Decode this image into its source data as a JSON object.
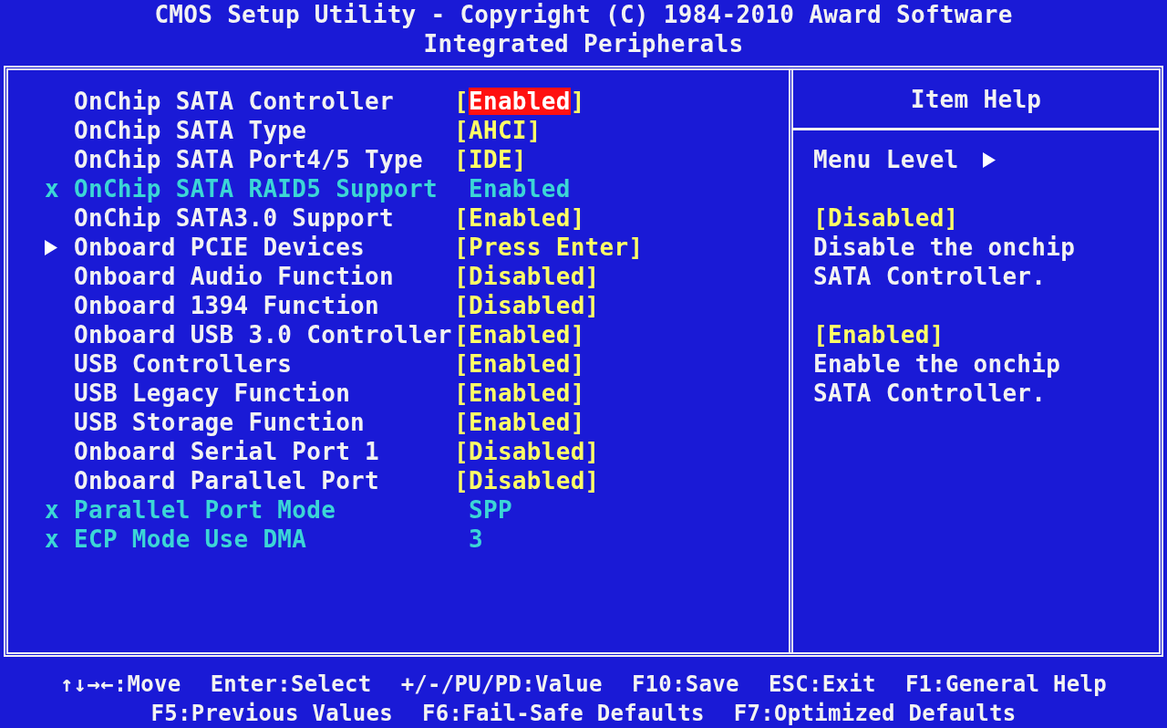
{
  "header": {
    "title": "CMOS Setup Utility - Copyright (C) 1984-2010 Award Software",
    "subtitle": "Integrated Peripherals"
  },
  "settings": [
    {
      "kind": "option",
      "label": "OnChip SATA Controller",
      "open": "[",
      "value": "Enabled",
      "close": "]",
      "selected": true
    },
    {
      "kind": "option",
      "label": "OnChip SATA Type",
      "open": "[",
      "value": "AHCI",
      "close": "]",
      "selected": false
    },
    {
      "kind": "option",
      "label": "OnChip SATA Port4/5 Type",
      "open": "[",
      "value": "IDE",
      "close": "]",
      "selected": false
    },
    {
      "kind": "locked",
      "marker": "x",
      "label": "OnChip SATA RAID5 Support",
      "value": "Enabled",
      "selected": false
    },
    {
      "kind": "option",
      "label": "OnChip SATA3.0 Support",
      "open": "[",
      "value": "Enabled",
      "close": "]",
      "selected": false
    },
    {
      "kind": "submenu",
      "label": "Onboard PCIE Devices",
      "open": "[",
      "value": "Press Enter",
      "close": "]",
      "selected": false
    },
    {
      "kind": "option",
      "label": "Onboard Audio Function",
      "open": "[",
      "value": "Disabled",
      "close": "]",
      "selected": false
    },
    {
      "kind": "option",
      "label": "Onboard 1394 Function",
      "open": "[",
      "value": "Disabled",
      "close": "]",
      "selected": false
    },
    {
      "kind": "option",
      "label": "Onboard USB 3.0 Controller",
      "open": "[",
      "value": "Enabled",
      "close": "]",
      "selected": false
    },
    {
      "kind": "option",
      "label": "USB Controllers",
      "open": "[",
      "value": "Enabled",
      "close": "]",
      "selected": false
    },
    {
      "kind": "option",
      "label": "USB Legacy Function",
      "open": "[",
      "value": "Enabled",
      "close": "]",
      "selected": false
    },
    {
      "kind": "option",
      "label": "USB Storage Function",
      "open": "[",
      "value": "Enabled",
      "close": "]",
      "selected": false
    },
    {
      "kind": "option",
      "label": "Onboard Serial Port 1",
      "open": "[",
      "value": "Disabled",
      "close": "]",
      "selected": false
    },
    {
      "kind": "option",
      "label": "Onboard Parallel Port",
      "open": "[",
      "value": "Disabled",
      "close": "]",
      "selected": false
    },
    {
      "kind": "locked",
      "marker": "x",
      "label": "Parallel Port Mode",
      "value": "SPP",
      "selected": false
    },
    {
      "kind": "locked",
      "marker": "x",
      "label": "ECP Mode Use DMA",
      "value": "3",
      "selected": false
    }
  ],
  "item_help": {
    "title": "Item Help",
    "menu_level": "Menu Level",
    "entries": [
      {
        "option": "[Disabled]",
        "lines": [
          "Disable the onchip",
          "SATA Controller."
        ]
      },
      {
        "option": "[Enabled]",
        "lines": [
          "Enable the onchip",
          "SATA Controller."
        ]
      }
    ]
  },
  "footer": [
    [
      "↑↓→←:Move",
      "Enter:Select",
      "+/-/PU/PD:Value",
      "F10:Save",
      "ESC:Exit",
      "F1:General Help"
    ],
    [
      "F5:Previous Values",
      "F6:Fail-Safe Defaults",
      "F7:Optimized Defaults"
    ]
  ]
}
